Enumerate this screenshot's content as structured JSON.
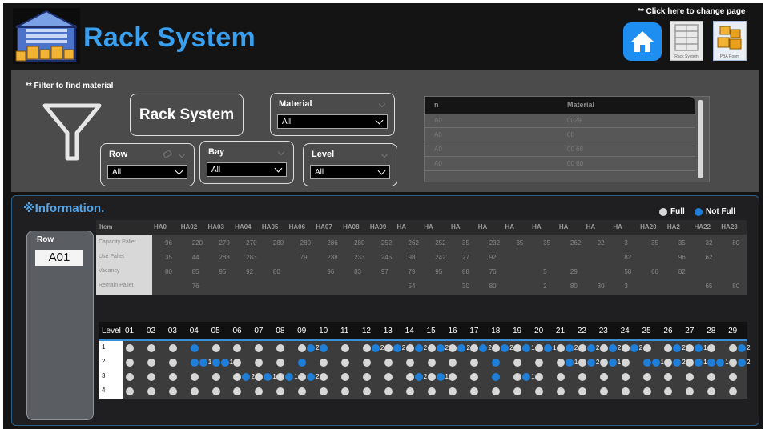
{
  "header": {
    "title": "Rack System",
    "page_hint": "** Click here to change page",
    "nav": {
      "rack_caption": "Rack System",
      "pba_caption": "PBA Room"
    }
  },
  "filters": {
    "hint": "** Filter to find material",
    "title_card": "Rack System",
    "slicers": {
      "material": {
        "label": "Material",
        "value": "All"
      },
      "row": {
        "label": "Row",
        "value": "All"
      },
      "bay": {
        "label": "Bay",
        "value": "All"
      },
      "level": {
        "label": "Level",
        "value": "All"
      }
    },
    "material_table": {
      "headers": [
        "n",
        "Material"
      ],
      "rows": [
        {
          "loc": "A0",
          "mat": "0029"
        },
        {
          "loc": "A0",
          "mat": "00"
        },
        {
          "loc": "A0",
          "mat": "00   68"
        },
        {
          "loc": "A0",
          "mat": "00   60"
        },
        {
          "loc": "",
          "mat": ""
        }
      ]
    }
  },
  "info": {
    "title": "※Information.",
    "legend": {
      "full": "Full",
      "not_full": "Not Full",
      "full_color": "#d7d7d7",
      "not_full_color": "#1f7fd8"
    },
    "row_card": {
      "label": "Row",
      "value": "A01"
    },
    "summary": {
      "corner": "Item",
      "headers": [
        "HA0",
        "HA02",
        "HA03",
        "HA04",
        "HA05",
        "HA06",
        "HA07",
        "HA08",
        "HA09",
        "HA",
        "HA",
        "HA",
        "HA",
        "HA",
        "HA",
        "HA",
        "HA",
        "HA",
        "HA20",
        "HA2",
        "HA22",
        "HA23"
      ],
      "row_labels": [
        "Capacity Pallet",
        "Use Pallet",
        "Vacancy",
        "Remain Pallet"
      ],
      "rows": [
        [
          "96",
          "220",
          "270",
          "270",
          "280",
          "280",
          "286",
          "280",
          "252",
          "262",
          "252",
          "35",
          "232",
          "35",
          "35",
          "262",
          "92",
          "3",
          "35",
          "35",
          "32",
          "80"
        ],
        [
          "35",
          "44",
          "288",
          "283",
          "",
          "79",
          "238",
          "233",
          "245",
          "98",
          "242",
          "27",
          "92",
          "",
          "",
          "",
          "",
          "82",
          "",
          "96",
          "62",
          ""
        ],
        [
          "80",
          "85",
          "95",
          "92",
          "80",
          "",
          "96",
          "83",
          "97",
          "79",
          "95",
          "88",
          "76",
          "",
          "5",
          "29",
          "",
          "58",
          "66",
          "82",
          "",
          ""
        ],
        [
          "",
          "76",
          "",
          "",
          "",
          "",
          "",
          "",
          "",
          "54",
          "",
          "30",
          "80",
          "",
          "2",
          "80",
          "30",
          "3",
          "",
          "",
          "65",
          "80"
        ]
      ]
    },
    "grid": {
      "level_header": "Level",
      "bays": [
        "01",
        "02",
        "03",
        "04",
        "05",
        "06",
        "07",
        "08",
        "09",
        "10",
        "11",
        "12",
        "13",
        "14",
        "15",
        "16",
        "17",
        "18",
        "19",
        "20",
        "21",
        "22",
        "23",
        "24",
        "25",
        "26",
        "27",
        "28",
        "29"
      ],
      "levels": [
        {
          "label": "1",
          "cells": [
            [
              0
            ],
            [
              0
            ],
            [
              0
            ],
            [
              1
            ],
            [
              0
            ],
            [
              0
            ],
            [
              0
            ],
            [
              0
            ],
            [
              0,
              2
            ],
            [
              1
            ],
            [
              0
            ],
            [
              0,
              2
            ],
            [
              0,
              2
            ],
            [
              0,
              2
            ],
            [
              0,
              2
            ],
            [
              0,
              2
            ],
            [
              0,
              2
            ],
            [
              0,
              2
            ],
            [
              0,
              1
            ],
            [
              0,
              1
            ],
            [
              0,
              2
            ],
            [
              0,
              2
            ],
            [
              0,
              2
            ],
            [
              0,
              2
            ],
            [
              0
            ],
            [
              0,
              2
            ],
            [
              0,
              1
            ],
            [
              0
            ],
            [
              0,
              2
            ]
          ]
        },
        {
          "label": "2",
          "cells": [
            [
              0
            ],
            [
              0
            ],
            [
              0
            ],
            [
              1,
              1
            ],
            [
              1,
              1
            ],
            [
              0
            ],
            [
              0
            ],
            [
              0
            ],
            [
              1
            ],
            [
              0
            ],
            [
              0
            ],
            [
              0
            ],
            [
              0
            ],
            [
              0
            ],
            [
              0
            ],
            [
              0
            ],
            [
              0
            ],
            [
              1
            ],
            [
              0
            ],
            [
              0
            ],
            [
              0,
              1
            ],
            [
              0,
              2
            ],
            [
              0,
              1
            ],
            [
              0
            ],
            [
              1,
              1
            ],
            [
              0,
              2
            ],
            [
              0,
              1
            ],
            [
              1,
              1
            ],
            [
              0,
              2
            ]
          ]
        },
        {
          "label": "3",
          "cells": [
            [
              0
            ],
            [
              0
            ],
            [
              0
            ],
            [
              0
            ],
            [
              0
            ],
            [
              0,
              2
            ],
            [
              0,
              1
            ],
            [
              0,
              1
            ],
            [
              0,
              2
            ],
            [
              0
            ],
            [
              0
            ],
            [
              0
            ],
            [
              0
            ],
            [
              0,
              2
            ],
            [
              0,
              1
            ],
            [
              0
            ],
            [
              0
            ],
            [
              1
            ],
            [
              0,
              1
            ],
            [
              0
            ],
            [
              0
            ],
            [
              0
            ],
            [
              0
            ],
            [
              0
            ],
            [
              0
            ],
            [
              0
            ],
            [
              0
            ],
            [
              0
            ],
            [
              0
            ]
          ]
        },
        {
          "label": "4",
          "cells": [
            [
              0
            ],
            [
              0
            ],
            [
              0
            ],
            [
              0
            ],
            [
              0
            ],
            [
              0
            ],
            [
              0
            ],
            [
              0
            ],
            [
              0
            ],
            [
              0
            ],
            [
              0
            ],
            [
              0
            ],
            [
              0
            ],
            [
              0
            ],
            [
              0
            ],
            [
              0
            ],
            [
              0
            ],
            [
              0
            ],
            [
              0
            ],
            [
              0
            ],
            [
              0
            ],
            [
              0
            ],
            [
              0
            ],
            [
              0
            ],
            [
              0
            ],
            [
              0
            ],
            [
              0
            ],
            [
              0
            ],
            [
              0
            ]
          ]
        }
      ]
    }
  }
}
